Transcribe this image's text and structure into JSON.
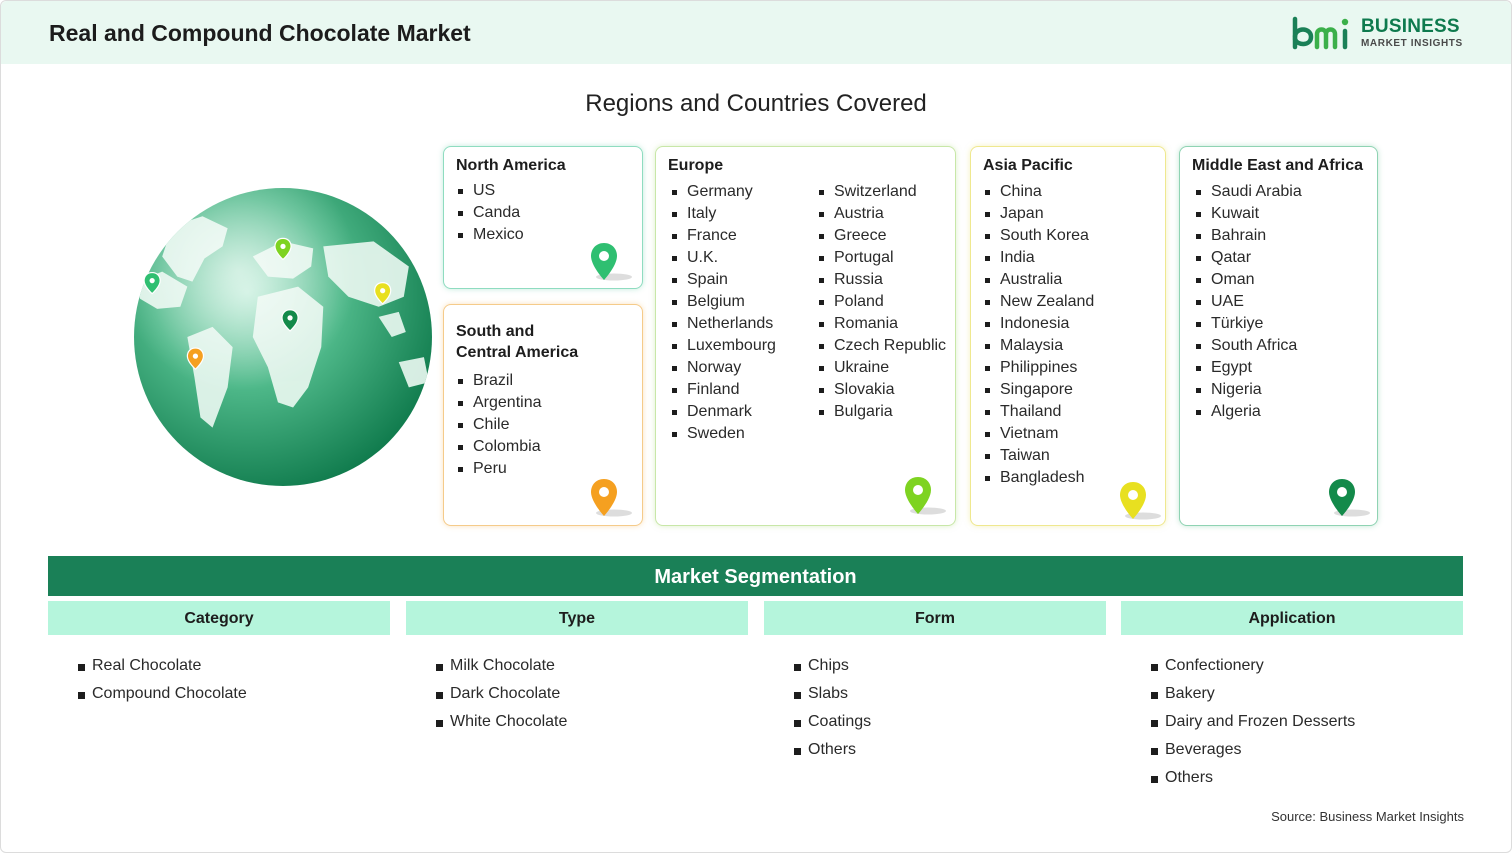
{
  "header": {
    "title": "Real and Compound Chocolate Market"
  },
  "logo": {
    "line1": "BUSINESS",
    "line2": "MARKET INSIGHTS"
  },
  "regions": {
    "title": "Regions and Countries Covered",
    "north_america": {
      "title": "North America",
      "countries": [
        "US",
        "Canda",
        "Mexico"
      ],
      "pin_color": "#2fbf71"
    },
    "south_america": {
      "title_line1": "South and",
      "title_line2": "Central America",
      "countries": [
        "Brazil",
        "Argentina",
        "Chile",
        "Colombia",
        "Peru"
      ],
      "pin_color": "#f5a020"
    },
    "europe": {
      "title": "Europe",
      "countries_col1": [
        "Germany",
        "Italy",
        "France",
        "U.K.",
        "Spain",
        "Belgium",
        "Netherlands",
        "Luxembourg",
        "Norway",
        "Finland",
        "Denmark",
        "Sweden"
      ],
      "countries_col2": [
        "Switzerland",
        "Austria",
        "Greece",
        "Portugal",
        "Russia",
        "Poland",
        "Romania",
        "Czech Republic",
        "Ukraine",
        "Slovakia",
        "Bulgaria"
      ],
      "pin_color": "#7ed321"
    },
    "asia_pacific": {
      "title": "Asia Pacific",
      "countries": [
        "China",
        "Japan",
        "South Korea",
        "India",
        "Australia",
        "New Zealand",
        "Indonesia",
        "Malaysia",
        "Philippines",
        "Singapore",
        "Thailand",
        "Vietnam",
        "Taiwan",
        "Bangladesh"
      ],
      "pin_color": "#e8e020"
    },
    "middle_east_africa": {
      "title": "Middle East and Africa",
      "countries": [
        "Saudi Arabia",
        "Kuwait",
        "Bahrain",
        "Qatar",
        "Oman",
        "UAE",
        "Türkiye",
        "South Africa",
        "Egypt",
        "Nigeria",
        "Algeria"
      ],
      "pin_color": "#138a4a"
    }
  },
  "segmentation": {
    "title": "Market Segmentation",
    "columns": [
      {
        "heading": "Category",
        "items": [
          "Real Chocolate",
          "Compound Chocolate"
        ]
      },
      {
        "heading": "Type",
        "items": [
          "Milk Chocolate",
          "Dark Chocolate",
          "White Chocolate"
        ]
      },
      {
        "heading": "Form",
        "items": [
          "Chips",
          "Slabs",
          "Coatings",
          "Others"
        ]
      },
      {
        "heading": "Application",
        "items": [
          "Confectionery",
          "Bakery",
          "Dairy and Frozen Desserts",
          "Beverages",
          "Others"
        ]
      }
    ]
  },
  "source": "Source: Business Market Insights",
  "colors": {
    "brand_green": "#1a8057",
    "header_bg": "#e9f8f1",
    "column_head_bg": "#b5f5dc"
  }
}
